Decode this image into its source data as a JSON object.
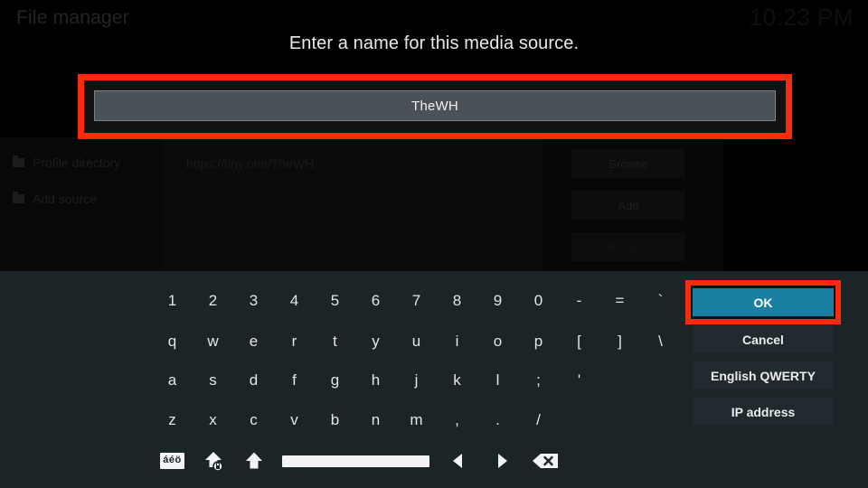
{
  "window": {
    "app_title": "File manager",
    "clock": "10:23 PM"
  },
  "dialog": {
    "prompt": "Enter a name for this media source.",
    "input": {
      "value": "TheWH",
      "placeholder": "",
      "highlighted": true,
      "highlight_color": "#fa2a0c"
    }
  },
  "background": {
    "sidebar_items": [
      {
        "label": "Profile directory",
        "icon": "folder-icon"
      },
      {
        "label": "Add source",
        "icon": "folder-icon"
      }
    ],
    "source_path": "https://tiny.one/TheWH",
    "buttons": [
      {
        "label": "Browse"
      },
      {
        "label": "Add"
      },
      {
        "label": "Remove"
      }
    ]
  },
  "keyboard": {
    "rows": [
      [
        "1",
        "2",
        "3",
        "4",
        "5",
        "6",
        "7",
        "8",
        "9",
        "0",
        "-",
        "=",
        "`"
      ],
      [
        "q",
        "w",
        "e",
        "r",
        "t",
        "y",
        "u",
        "i",
        "o",
        "p",
        "[",
        "]",
        "\\"
      ],
      [
        "a",
        "s",
        "d",
        "f",
        "g",
        "h",
        "j",
        "k",
        "l",
        ";",
        "'"
      ],
      [
        "z",
        "x",
        "c",
        "v",
        "b",
        "n",
        "m",
        ",",
        ".",
        "/"
      ]
    ],
    "function_row": [
      {
        "name": "accents-key",
        "label": "áéö"
      },
      {
        "name": "caps-lock-key",
        "label": ""
      },
      {
        "name": "shift-key",
        "label": ""
      },
      {
        "name": "space-key",
        "label": ""
      },
      {
        "name": "cursor-left-key",
        "label": ""
      },
      {
        "name": "cursor-right-key",
        "label": ""
      },
      {
        "name": "backspace-key",
        "label": ""
      }
    ]
  },
  "actions": {
    "ok": {
      "label": "OK",
      "focused": true,
      "color": "#1b7fa1"
    },
    "cancel": {
      "label": "Cancel"
    },
    "layout": {
      "label": "English QWERTY"
    },
    "ip": {
      "label": "IP address"
    }
  }
}
